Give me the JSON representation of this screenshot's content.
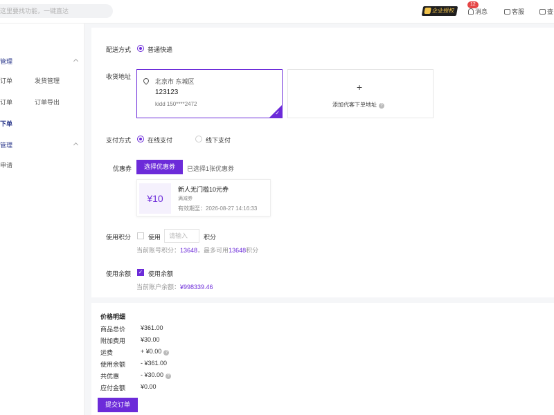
{
  "header": {
    "search_placeholder": "这里要找功能，一键直达",
    "enterprise_badge": "企业授权",
    "notif_count": "12",
    "messages": "消息",
    "service": "客服",
    "more": "查"
  },
  "sidebar": {
    "group1": "管理",
    "item_orders": "订单",
    "item_shipping": "发货管理",
    "item_orders2": "订单",
    "item_export": "订单导出",
    "item_place": "下单",
    "group2": "管理",
    "item_apply": "申请"
  },
  "form": {
    "delivery_label": "配送方式",
    "delivery_option": "普通快递",
    "address_label": "收货地址",
    "address_region": "北京市 东城区",
    "address_detail": "123123",
    "address_contact": "kidd 150****2472",
    "add_address": "添加代客下单地址",
    "payment_label": "支付方式",
    "pay_online": "在线支付",
    "pay_offline": "线下支付",
    "coupon_label": "优惠券",
    "coupon_button": "选择优惠券",
    "coupon_selected": "已选择1张优惠券",
    "coupon_value": "¥10",
    "coupon_title": "新人无门槛10元券",
    "coupon_type": "满减券",
    "coupon_expiry": "有效期至：2026-08-27 14:16:33",
    "points_label": "使用积分",
    "points_use": "使用",
    "points_placeholder": "请输入",
    "points_unit": "积分",
    "points_hint_prefix": "当前账号积分：",
    "points_current": "13648",
    "points_hint_mid": "，最多可用",
    "points_max": "13648",
    "points_hint_suffix": "积分",
    "balance_label": "使用余额",
    "balance_use": "使用余额",
    "balance_hint_prefix": "当前账户余额：",
    "balance_amount": "¥998339.46"
  },
  "price": {
    "title": "价格明细",
    "rows": [
      {
        "label": "商品总价",
        "value": "¥361.00"
      },
      {
        "label": "附加费用",
        "value": "¥30.00"
      },
      {
        "label": "运费",
        "value": "+ ¥0.00"
      },
      {
        "label": "使用余额",
        "value": "- ¥361.00"
      },
      {
        "label": "共优惠",
        "value": "- ¥30.00"
      },
      {
        "label": "应付金额",
        "value": "¥0.00"
      }
    ],
    "submit": "提交订单"
  },
  "colors": {
    "accent": "#6c2bd9",
    "badge_bg": "#1f1f1f",
    "badge_fg": "#f0c24b",
    "notif": "#e54545"
  }
}
